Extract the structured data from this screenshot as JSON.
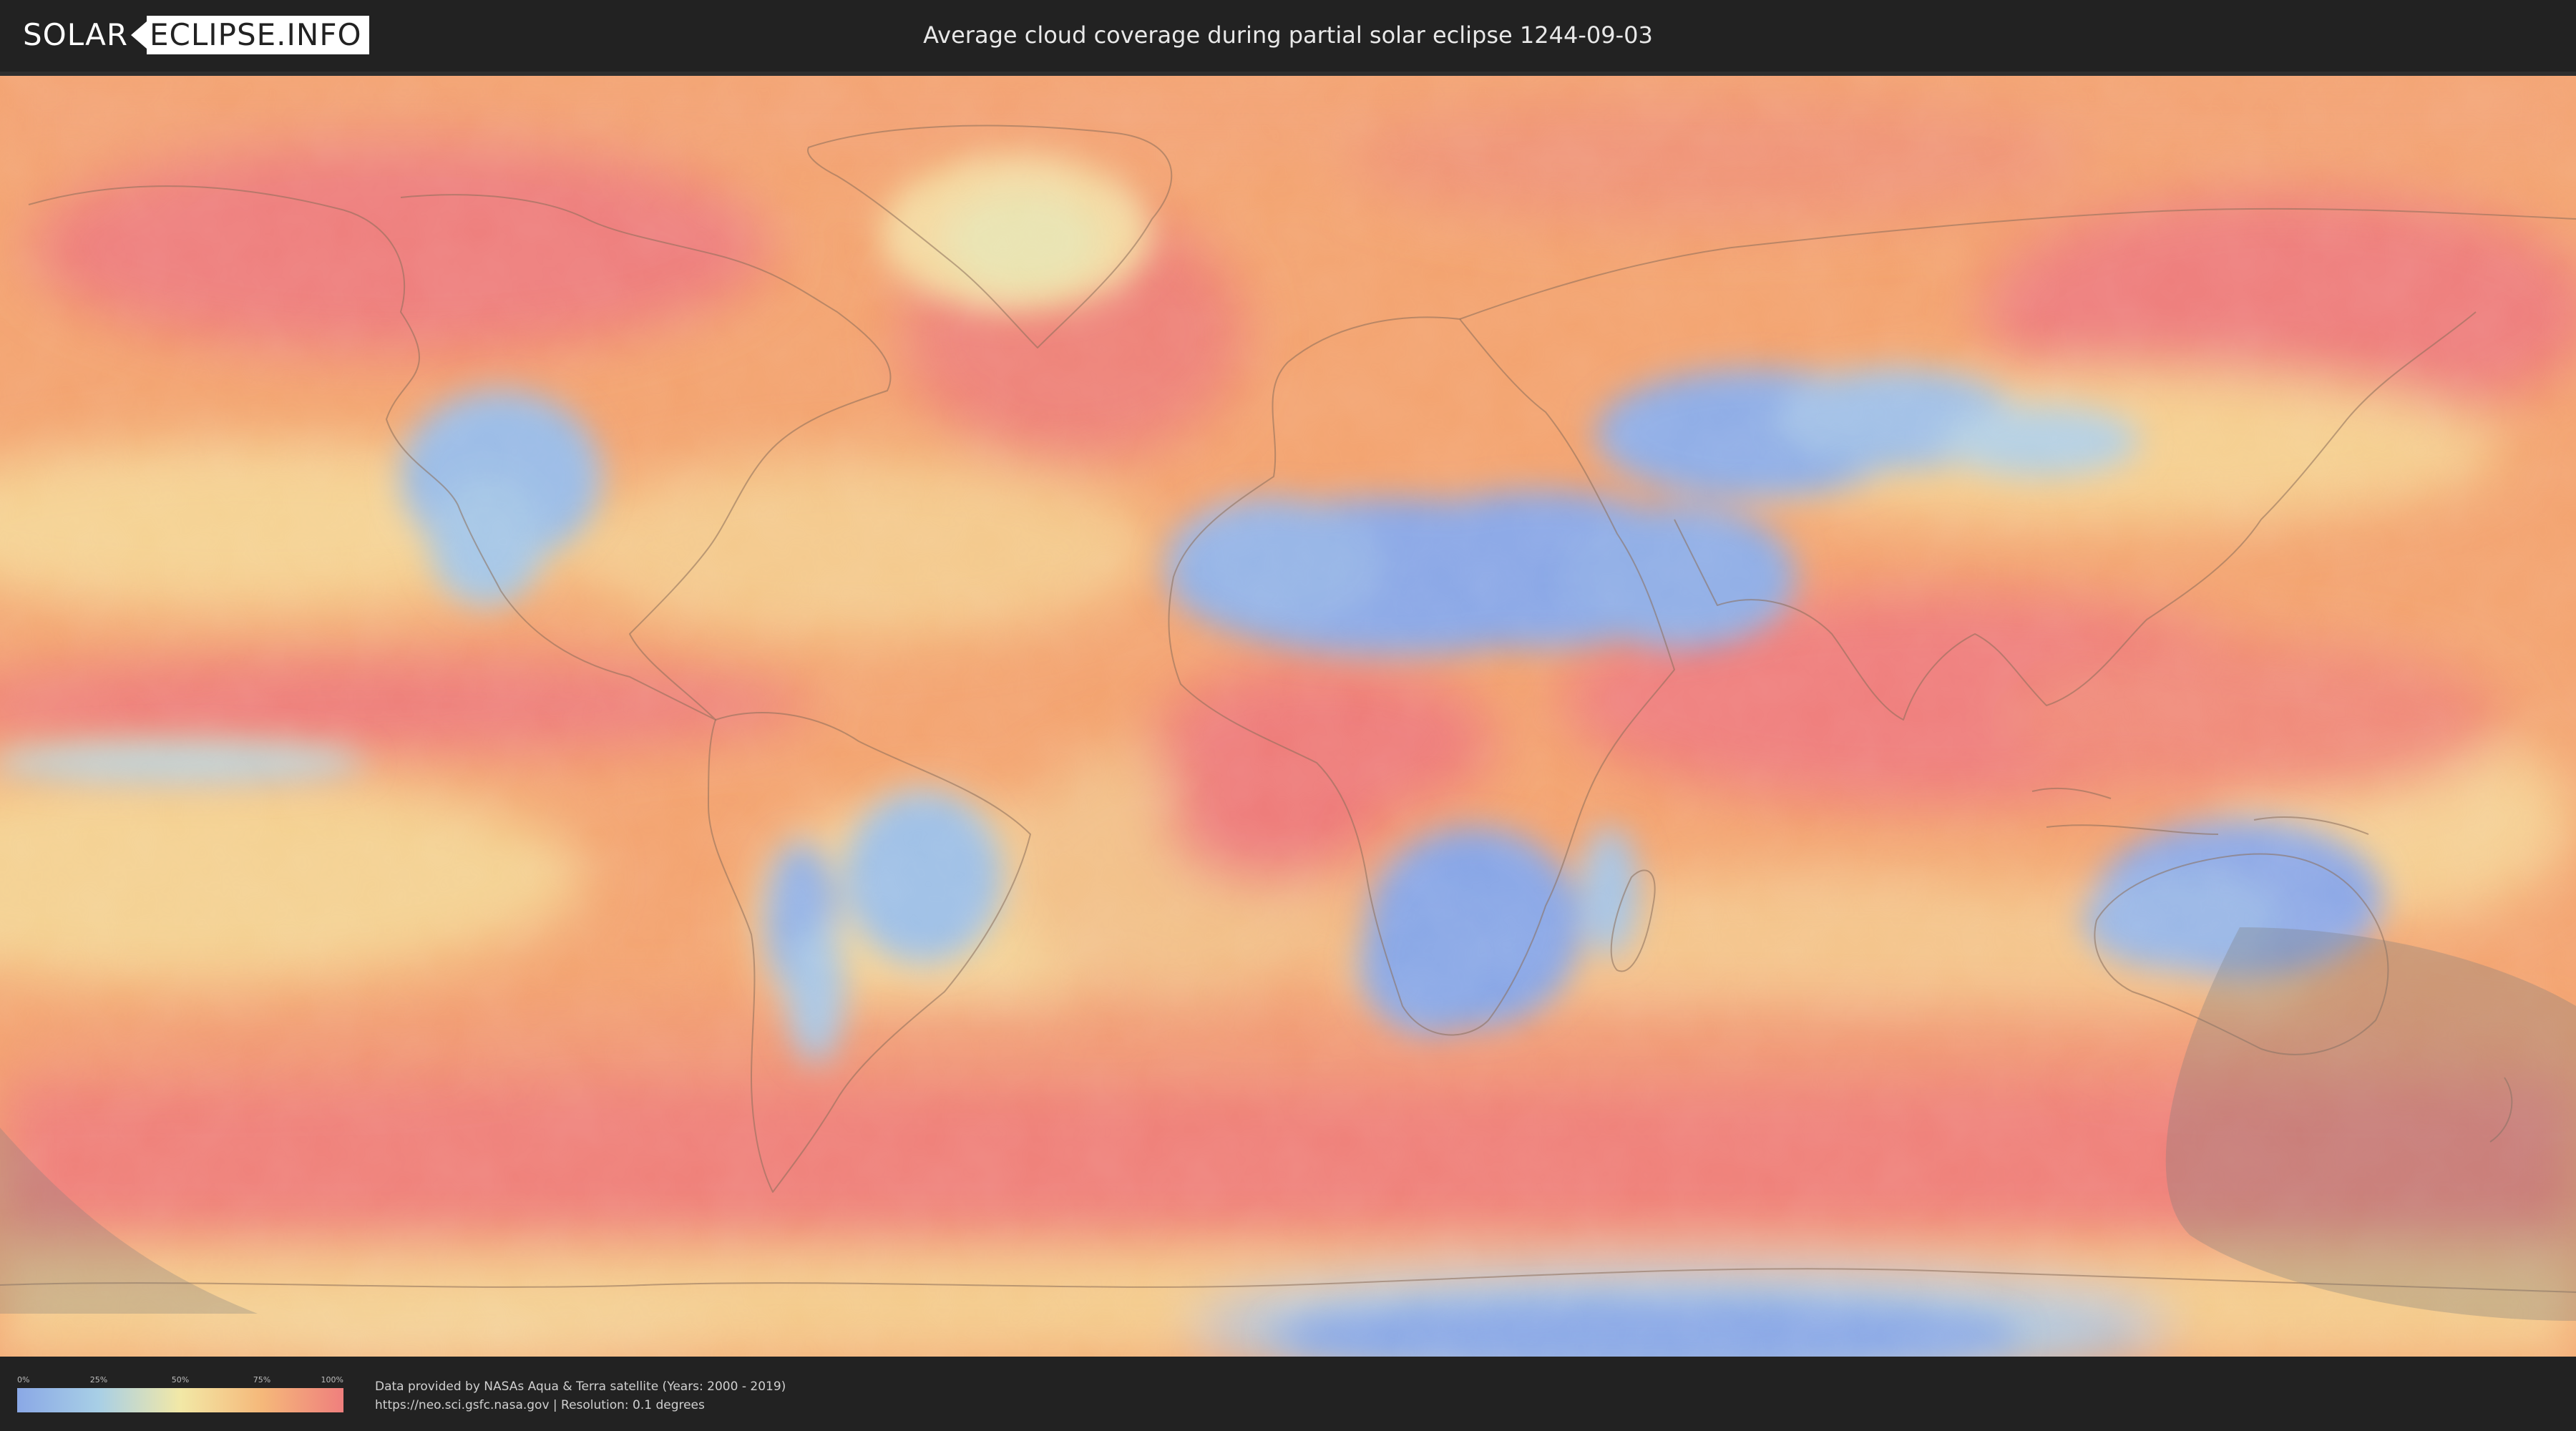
{
  "header": {
    "logo_left": "SOLAR",
    "logo_right": "ECLIPSE.INFO",
    "title": "Average cloud coverage during partial solar eclipse 1244-09-03"
  },
  "legend": {
    "ticks": [
      "0%",
      "25%",
      "50%",
      "75%",
      "100%"
    ],
    "values": [
      0,
      25,
      50,
      75,
      100
    ],
    "colors": [
      "#8aa8e6",
      "#a8cfe6",
      "#f2e8a6",
      "#f5b87a",
      "#ef7f7d"
    ]
  },
  "credits": {
    "line1": "Data provided by NASAs Aqua & Terra satellite (Years: 2000 - 2019)",
    "line2": "https://neo.sci.gsfc.nasa.gov | Resolution: 0.1 degrees"
  },
  "map": {
    "colors": {
      "ocean_high": "#ee7e7c",
      "ocean_mid": "#f3a36f",
      "mid": "#f4cf8e",
      "low": "#9fc1e4",
      "very_low": "#88a6e4",
      "shadow": "#7d7d7d"
    }
  }
}
